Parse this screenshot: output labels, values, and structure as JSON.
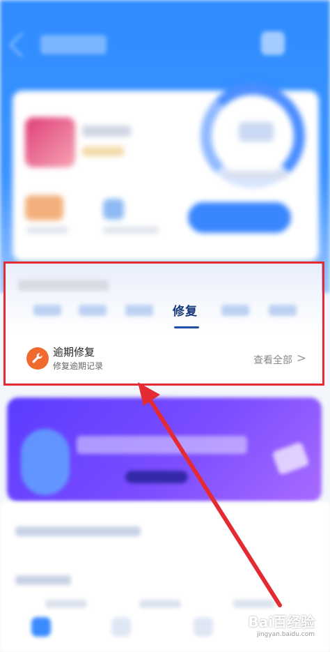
{
  "app": {
    "repair_section": {
      "active_tab_label": "修复",
      "item": {
        "title": "逾期修复",
        "subtitle": "修复逾期记录",
        "view_all": "查看全部",
        "arrow": ">"
      }
    }
  },
  "colors": {
    "header_blue": "#2f8cff",
    "highlight_red": "#e42b33",
    "repair_icon_orange": "#f06a2e",
    "banner_purple": "#6b45ff"
  },
  "icons": {
    "repair_icon": "wrench-icon",
    "back_icon": "back-arrow-icon",
    "chevron": "chevron-right-icon"
  },
  "watermark": {
    "title": "Bai百经验",
    "subtitle": "jingyan.baidu.com"
  }
}
